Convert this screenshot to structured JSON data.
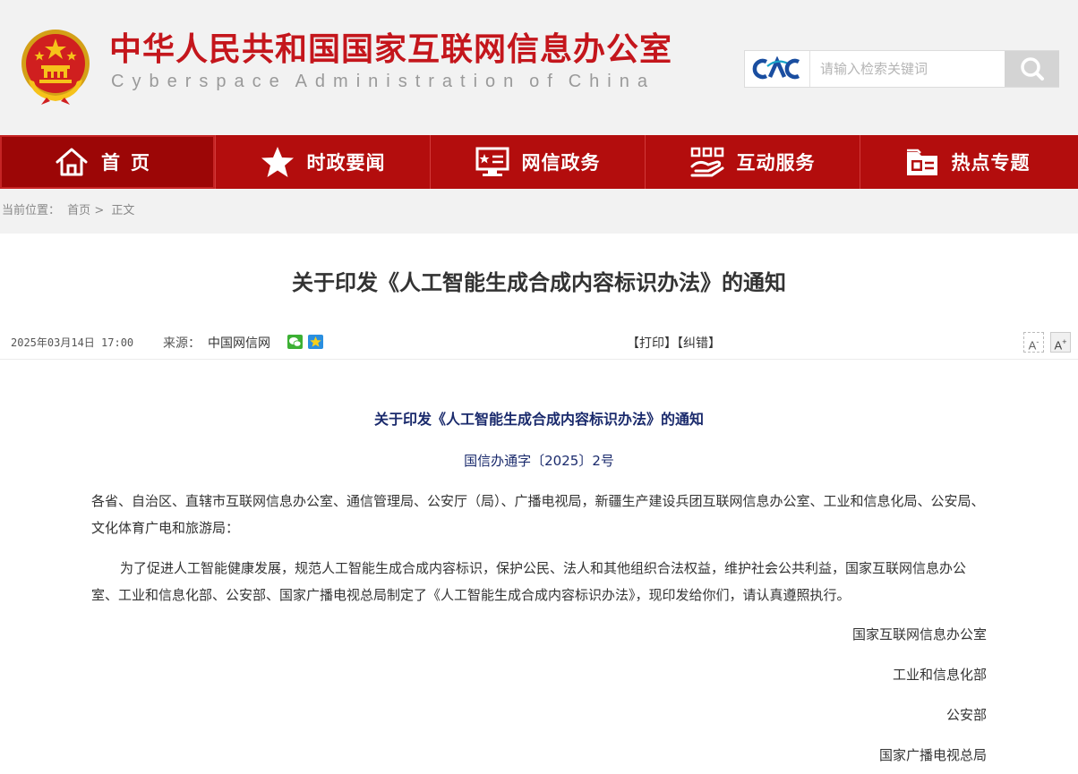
{
  "header": {
    "title_cn": "中华人民共和国国家互联网信息办公室",
    "title_en_words": [
      "Cyberspace",
      "Administration",
      "of",
      "China"
    ],
    "search_logo": "CAC",
    "search_placeholder": "请输入检索关键词",
    "search_icon": "search-icon",
    "brand_color": "#c4161c"
  },
  "nav": {
    "bg_color": "#b30d0d",
    "items": [
      {
        "label": "首页",
        "icon": "home-icon"
      },
      {
        "label": "时政要闻",
        "icon": "star-icon"
      },
      {
        "label": "网信政务",
        "icon": "monitor-icon"
      },
      {
        "label": "互动服务",
        "icon": "handshake-icon"
      },
      {
        "label": "热点专题",
        "icon": "folder-icon"
      }
    ]
  },
  "breadcrumb": {
    "prefix": "当前位置：",
    "home": "首页",
    "sep": ">",
    "current": "正文"
  },
  "article": {
    "title": "关于印发《人工智能生成合成内容标识办法》的通知",
    "date": "2025年03月14日 17:00",
    "source_label": "来源：",
    "source": "中国网信网",
    "print": "【打印】",
    "correct": "【纠错】",
    "font_dec": "A",
    "font_inc": "A",
    "doc_title": "关于印发《人工智能生成合成内容标识办法》的通知",
    "doc_no": "国信办通字〔2025〕2号",
    "para1": "各省、自治区、直辖市互联网信息办公室、通信管理局、公安厅（局）、广播电视局，新疆生产建设兵团互联网信息办公室、工业和信息化局、公安局、文化体育广电和旅游局：",
    "para2": "为了促进人工智能健康发展，规范人工智能生成合成内容标识，保护公民、法人和其他组织合法权益，维护社会公共利益，国家互联网信息办公室、工业和信息化部、公安部、国家广播电视总局制定了《人工智能生成合成内容标识办法》，现印发给你们，请认真遵照执行。",
    "signatories": [
      "国家互联网信息办公室",
      "工业和信息化部",
      "公安部",
      "国家广播电视总局"
    ]
  }
}
